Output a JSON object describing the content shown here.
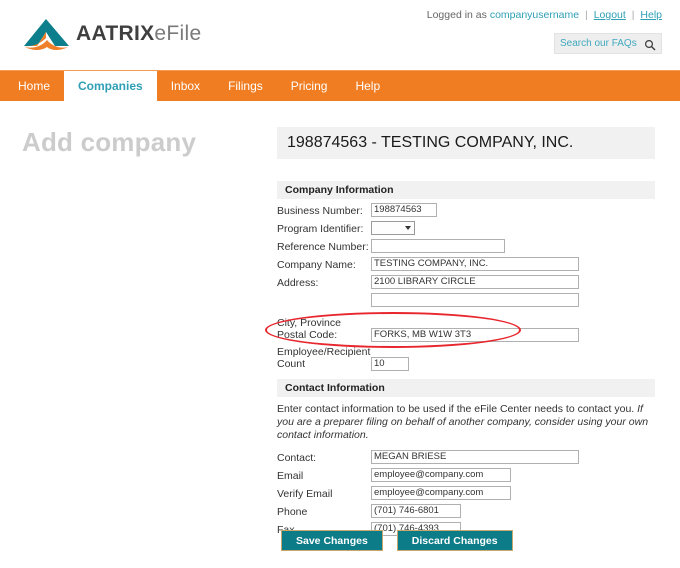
{
  "header": {
    "logo": {
      "icon": "aatrix-mountain-logo",
      "brand_bold": "AATRIX",
      "brand_light": "eFile",
      "teal": "#0d7f8c",
      "orange": "#ef7f28"
    },
    "login": {
      "prefix": "Logged in as",
      "username": "companyusername",
      "logout_label": "Logout",
      "help_label": "Help",
      "separator": "|"
    },
    "search": {
      "placeholder": "Search our FAQs",
      "icon": "search-icon"
    }
  },
  "nav": {
    "items": [
      {
        "label": "Home",
        "active": false
      },
      {
        "label": "Companies",
        "active": true
      },
      {
        "label": "Inbox",
        "active": false
      },
      {
        "label": "Filings",
        "active": false
      },
      {
        "label": "Pricing",
        "active": false
      },
      {
        "label": "Help",
        "active": false
      }
    ],
    "bar_color": "#f07d22",
    "active_text_color": "#2f9fb5"
  },
  "page": {
    "title": "Add company",
    "company_banner": "198874563 - TESTING COMPANY, INC."
  },
  "company_section": {
    "heading": "Company Information",
    "fields": {
      "business_number_label": "Business Number:",
      "business_number_value": "198874563",
      "program_identifier_label": "Program Identifier:",
      "program_identifier_value": "",
      "reference_number_label": "Reference Number:",
      "reference_number_value": "",
      "company_name_label": "Company Name:",
      "company_name_value": "TESTING COMPANY, INC.",
      "address_label": "Address:",
      "address_value": "2100 LIBRARY CIRCLE",
      "address2_value": "",
      "city_label_line1": "City, Province",
      "city_label_line2": "Postal Code:",
      "city_value": "FORKS, MB W1W 3T3",
      "count_label_line1": "Employee/Recipient",
      "count_label_line2": "Count",
      "count_value": "10"
    }
  },
  "contact_section": {
    "heading": "Contact Information",
    "help_text_normal": "Enter contact information to be used if the eFile Center needs to contact you. ",
    "help_text_italic": "If you are a preparer filing on behalf of another company, consider using your own contact information.",
    "fields": {
      "contact_label": "Contact:",
      "contact_value": "MEGAN BRIESE",
      "email_label": "Email",
      "email_value": "employee@company.com",
      "verify_email_label": "Verify Email",
      "verify_email_value": "employee@company.com",
      "phone_label": "Phone",
      "phone_value": "(701) 746-6801",
      "fax_label": "Fax",
      "fax_value": "(701) 746-4393"
    }
  },
  "actions": {
    "save_label": "Save Changes",
    "discard_label": "Discard Changes",
    "button_color": "#0b7c88"
  },
  "annotation": {
    "type": "red-ellipse-highlight",
    "color": "#e8262d"
  }
}
